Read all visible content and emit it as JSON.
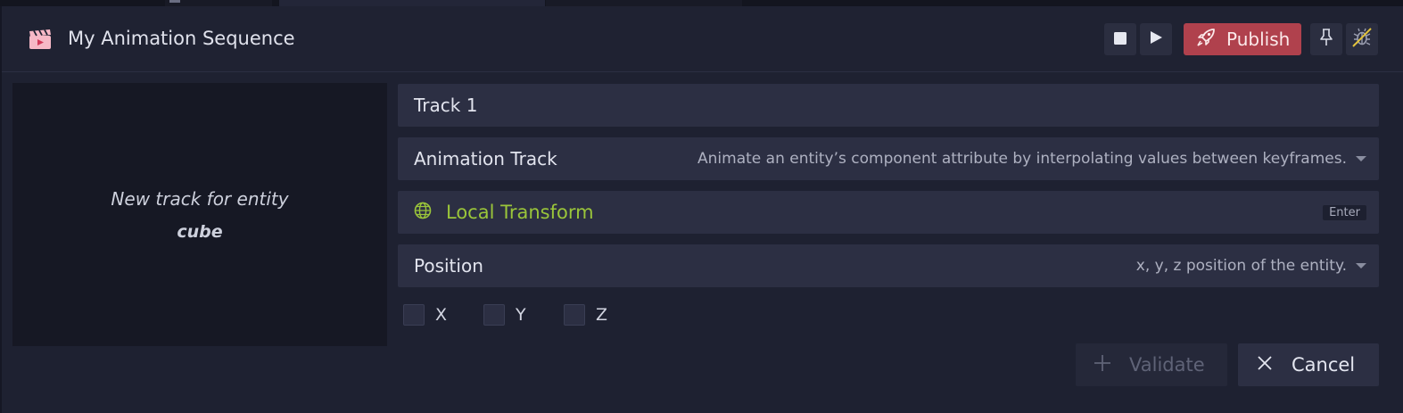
{
  "header": {
    "title": "My Animation Sequence",
    "app_icon": "clapperboard-icon",
    "stop_icon": "stop-icon",
    "play_icon": "play-icon",
    "publish_label": "Publish",
    "publish_icon": "rocket-icon",
    "pin_icon": "pin-icon",
    "debug_icon": "bug-off-icon"
  },
  "preview": {
    "line1": "New track for entity",
    "entity": "cube"
  },
  "form": {
    "track_name": "Track 1",
    "track_type": {
      "label": "Animation Track",
      "description": "Animate an entity’s component attribute by interpolating values between keyframes."
    },
    "component": {
      "icon": "globe-icon",
      "label": "Local Transform",
      "shortcut": "Enter"
    },
    "attribute": {
      "label": "Position",
      "description": "x, y, z position of the entity."
    },
    "axes": [
      {
        "label": "X",
        "checked": false
      },
      {
        "label": "Y",
        "checked": false
      },
      {
        "label": "Z",
        "checked": false
      }
    ]
  },
  "actions": {
    "validate_label": "Validate",
    "cancel_label": "Cancel"
  },
  "colors": {
    "accent_publish": "#b0414d",
    "component_green": "#9ac53a",
    "background": "#1e2131"
  }
}
